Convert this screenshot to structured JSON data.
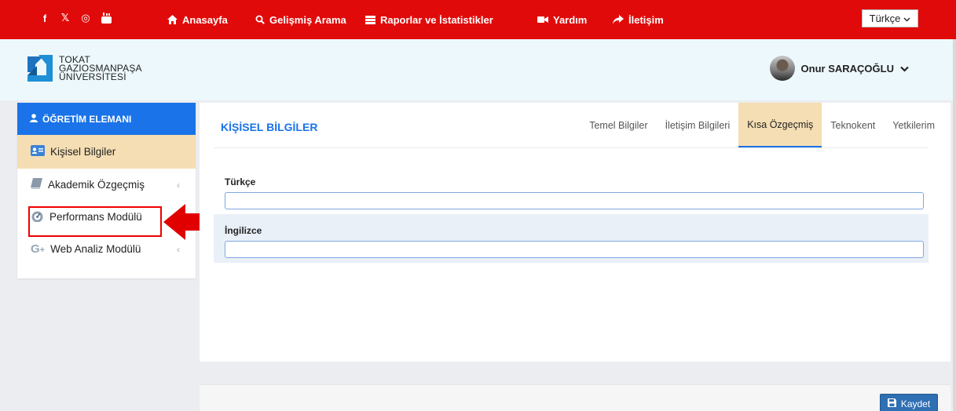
{
  "topbar": {
    "social": [
      {
        "icon": "facebook-icon",
        "glyph": "f"
      },
      {
        "icon": "x-twitter-icon",
        "glyph": "𝕏"
      },
      {
        "icon": "instagram-icon",
        "glyph": "◎"
      },
      {
        "icon": "youtube-icon",
        "glyph": "▶"
      }
    ],
    "nav": [
      {
        "icon": "home-icon",
        "label": "Anasayfa"
      },
      {
        "icon": "search-icon",
        "label": "Gelişmiş Arama"
      },
      {
        "icon": "list-icon",
        "label": "Raporlar ve İstatistikler"
      },
      {
        "icon": "video-icon",
        "label": "Yardım"
      },
      {
        "icon": "share-arrow-icon",
        "label": "İletişim"
      }
    ],
    "language": "Türkçe"
  },
  "header": {
    "logo_lines": [
      "TOKAT",
      "GAZIOSMANPAŞA",
      "ÜNİVERSİTESİ"
    ],
    "user_name": "Onur SARAÇOĞLU"
  },
  "sidebar": {
    "heading": "ÖĞRETİM ELEMANI",
    "items": [
      {
        "label": "Kişisel Bilgiler",
        "icon": "id-card-icon",
        "active": true
      },
      {
        "label": "Akademik Özgeçmiş",
        "icon": "book-icon",
        "chevron": "‹"
      },
      {
        "label": "Performans Modülü",
        "icon": "dashboard-icon"
      },
      {
        "label": "Web Analiz Modülü",
        "icon": "google-plus-icon",
        "chevron": "‹"
      }
    ]
  },
  "panel": {
    "title": "KİŞİSEL BİLGİLER",
    "tabs": [
      "Temel Bilgiler",
      "İletişim Bilgileri",
      "Kısa Özgeçmiş",
      "Teknokent",
      "Yetkilerim"
    ],
    "active_tab": "Kısa Özgeçmiş",
    "fields": [
      {
        "label": "Türkçe",
        "value": ""
      },
      {
        "label": "İngilizce",
        "value": ""
      }
    ]
  },
  "footer": {
    "save_label": "Kaydet"
  },
  "colors": {
    "topbar": "#e10a0a",
    "accent": "#1a73e8",
    "active_bg": "#f5deb3",
    "highlight": "#ee0000",
    "save": "#2f6fb3"
  }
}
